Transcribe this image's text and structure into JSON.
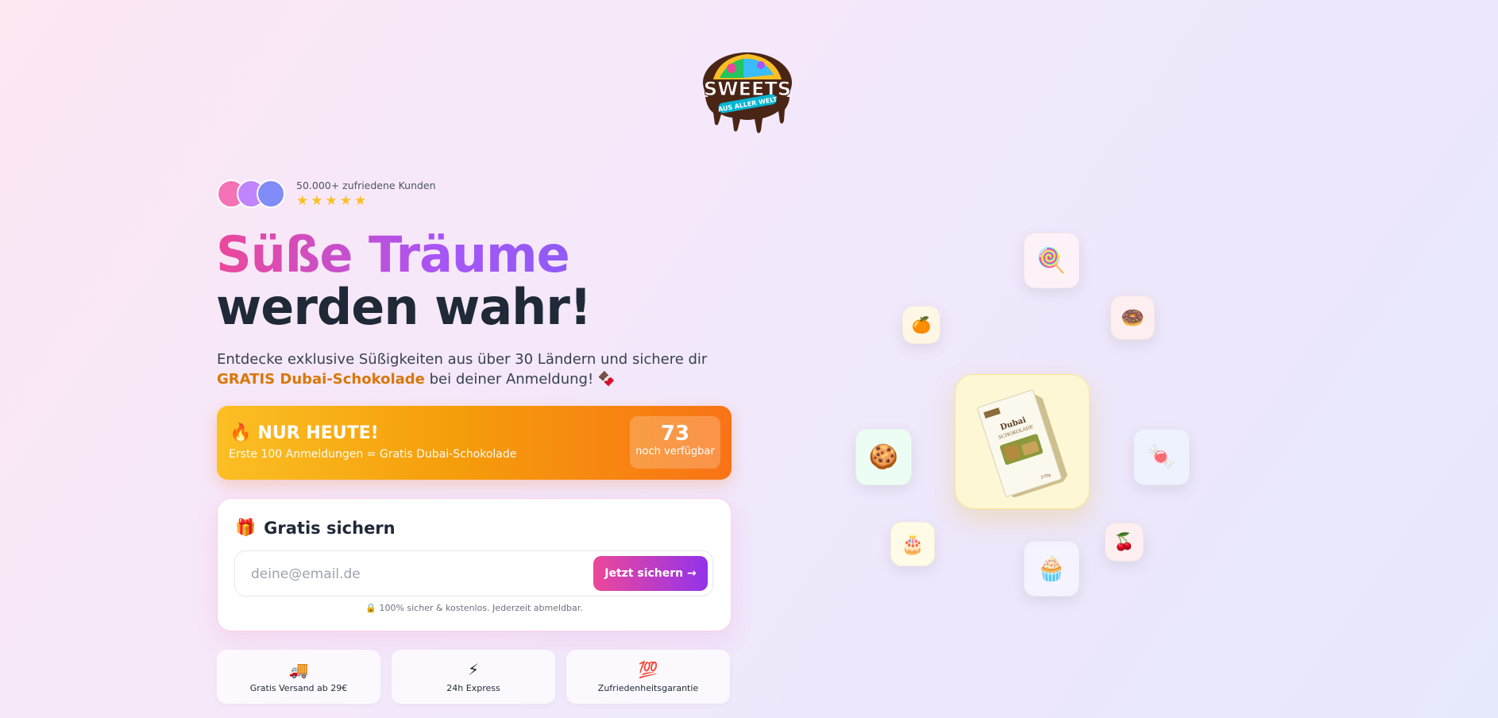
{
  "logo": {
    "word": "SWEETS",
    "tagline": "AUS ALLER WELT"
  },
  "social_proof": {
    "count_text": "50.000+ zufriedene Kunden",
    "rating_stars": 5
  },
  "hero": {
    "headline_line1": "Süße Träume",
    "headline_line2": "werden wahr!",
    "subtitle_pre": "Entdecke exklusive Süßigkeiten aus über 30 Ländern und sichere dir ",
    "subtitle_highlight": "GRATIS Dubai-Schokolade",
    "subtitle_post": " bei deiner Anmeldung! 🍫"
  },
  "banner": {
    "icon": "🔥",
    "title": "NUR HEUTE!",
    "subtitle": "Erste 100 Anmeldungen = Gratis Dubai-Schokolade",
    "counter_value": "73",
    "counter_label": "noch verfügbar"
  },
  "signup": {
    "icon": "🎁",
    "title": "Gratis sichern",
    "email_placeholder": "deine@email.de",
    "email_value": "",
    "button_label": "Jetzt sichern →",
    "secure_note": "🔒 100% sicher & kostenlos. Jederzeit abmeldbar."
  },
  "features": [
    {
      "icon": "🚚",
      "label": "Gratis Versand ab 29€"
    },
    {
      "icon": "⚡",
      "label": "24h Express"
    },
    {
      "icon": "💯",
      "label": "Zufriedenheitsgarantie"
    }
  ],
  "product": {
    "brand": "Dubai",
    "name": "SCHOKOLADE",
    "weight": "270g"
  },
  "floating_icons": [
    {
      "emoji": "🍭",
      "bg": "#fdf2f8"
    },
    {
      "emoji": "🍊",
      "bg": "#fff7e6"
    },
    {
      "emoji": "🍩",
      "bg": "#fdeef0"
    },
    {
      "emoji": "🍪",
      "bg": "#ecfdf3"
    },
    {
      "emoji": "🍬",
      "bg": "#eef2ff"
    },
    {
      "emoji": "🎂",
      "bg": "#fefbe6"
    },
    {
      "emoji": "🍒",
      "bg": "#fdeef0"
    },
    {
      "emoji": "🧁",
      "bg": "#f5f3ff"
    }
  ],
  "colors": {
    "accent_pink": "#ec4899",
    "accent_purple": "#9333ea",
    "highlight_orange": "#d97706",
    "banner_start": "#fbbf24",
    "banner_end": "#f97316"
  }
}
